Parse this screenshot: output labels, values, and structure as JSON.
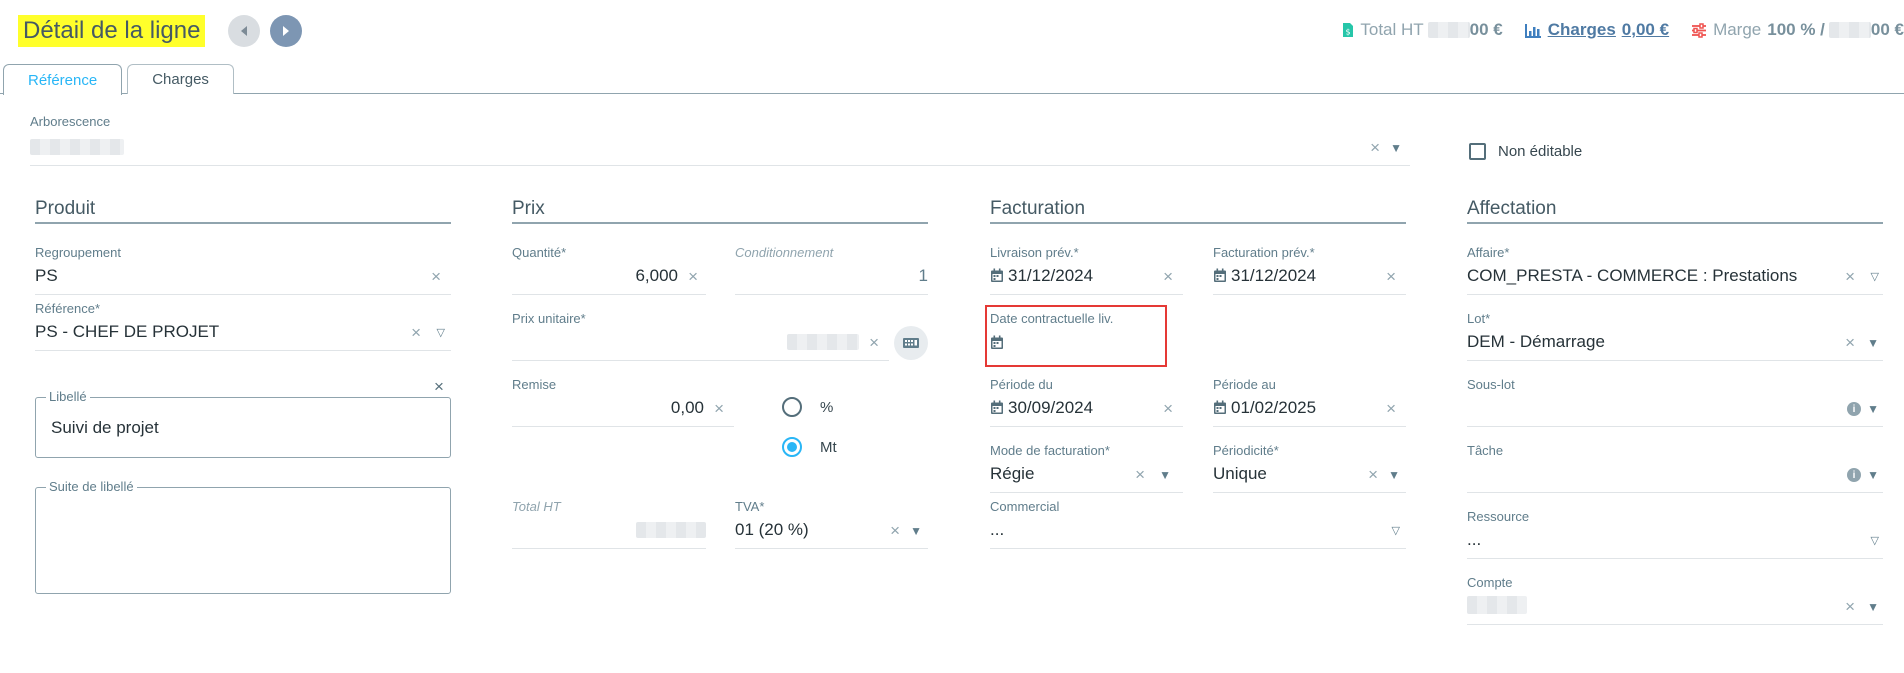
{
  "header": {
    "title": "Détail de la ligne",
    "total_ht_label": "Total HT",
    "total_ht_suffix": "00 €",
    "charges_label": "Charges",
    "charges_value": "0,00 €",
    "marge_label": "Marge",
    "marge_value": "100 % /",
    "marge_suffix": "00 €"
  },
  "tabs": [
    {
      "label": "Référence",
      "active": true
    },
    {
      "label": "Charges",
      "active": false
    }
  ],
  "arborescence": {
    "label": "Arborescence"
  },
  "non_editable": {
    "label": "Non éditable",
    "checked": false
  },
  "sections": {
    "produit": "Produit",
    "prix": "Prix",
    "facturation": "Facturation",
    "affectation": "Affectation"
  },
  "produit": {
    "regroupement": {
      "label": "Regroupement",
      "value": "PS"
    },
    "reference": {
      "label": "Référence*",
      "value": "PS - CHEF DE PROJET"
    },
    "libelle": {
      "label": "Libellé",
      "value": "Suivi de projet"
    },
    "suite_libelle": {
      "label": "Suite de libellé",
      "value": ""
    }
  },
  "prix": {
    "quantite": {
      "label": "Quantité*",
      "value": "6,000"
    },
    "conditionnement": {
      "label": "Conditionnement",
      "value": "1"
    },
    "prix_unitaire": {
      "label": "Prix unitaire*"
    },
    "remise": {
      "label": "Remise",
      "value": "0,00"
    },
    "remise_mode": {
      "options": [
        "%",
        "Mt"
      ],
      "selected": "Mt"
    },
    "total_ht": {
      "label": "Total HT"
    },
    "tva": {
      "label": "TVA*",
      "value": "01 (20 %)"
    }
  },
  "facturation": {
    "livraison_prev": {
      "label": "Livraison prév.*",
      "value": "31/12/2024"
    },
    "facturation_prev": {
      "label": "Facturation prév.*",
      "value": "31/12/2024"
    },
    "date_contractuelle": {
      "label": "Date contractuelle liv.",
      "value": ""
    },
    "periode_du": {
      "label": "Période du",
      "value": "30/09/2024"
    },
    "periode_au": {
      "label": "Période au",
      "value": "01/02/2025"
    },
    "mode_facturation": {
      "label": "Mode de facturation*",
      "value": "Régie"
    },
    "periodicite": {
      "label": "Périodicité*",
      "value": "Unique"
    },
    "commercial": {
      "label": "Commercial",
      "value": "..."
    }
  },
  "affectation": {
    "affaire": {
      "label": "Affaire*",
      "value": "COM_PRESTA - COMMERCE : Prestations"
    },
    "lot": {
      "label": "Lot*",
      "value": "DEM - Démarrage"
    },
    "sous_lot": {
      "label": "Sous-lot",
      "value": ""
    },
    "tache": {
      "label": "Tâche",
      "value": ""
    },
    "ressource": {
      "label": "Ressource",
      "value": "..."
    },
    "compte": {
      "label": "Compte"
    }
  },
  "icons": {
    "clear": "×",
    "caret_solid": "▼",
    "caret_hollow": "▽",
    "info": "i"
  },
  "colors": {
    "title_highlight": "#ffff2b",
    "accent": "#29b6f6",
    "total_icon": "#26c6a9",
    "charges_icon": "#3f7fbf",
    "marge_icon": "#ef5350",
    "annotation_box": "#e53935"
  }
}
